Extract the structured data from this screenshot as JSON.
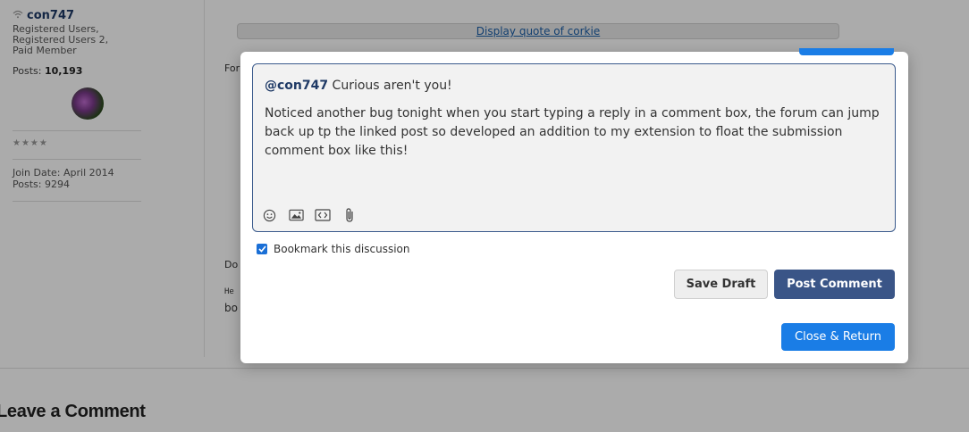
{
  "author": {
    "username": "con747",
    "roles": [
      "Registered Users,",
      "Registered Users 2,",
      "Paid Member"
    ],
    "posts_label": "Posts:",
    "posts_count": "10,193",
    "stars": "★★★★",
    "join_date": "Join Date: April 2014",
    "posts_alt": "Posts: 9294"
  },
  "thread": {
    "quote_link": "Display quote of corkie",
    "stub_for": "For",
    "stub_do": "Do",
    "stub_he": "He",
    "stub_bo": "bo"
  },
  "page": {
    "leave_comment": "Leave a Comment"
  },
  "editor": {
    "mention": "@con747",
    "first_line_rest": " Curious aren't you!",
    "paragraph": "Noticed another bug tonight when you start typing a reply in a comment box, the forum can jump back up tp the linked post so developed an addition to my extension to float the submission comment box like this!",
    "toolbar_icons": [
      "emoji-icon",
      "image-icon",
      "code-icon",
      "attachment-icon"
    ]
  },
  "bookmark": {
    "label": "Bookmark this discussion",
    "checked": true
  },
  "buttons": {
    "save_draft": "Save Draft",
    "post_comment": "Post Comment",
    "close_return": "Close & Return"
  },
  "colors": {
    "accent": "#1a7de6",
    "post_button": "#3a5587",
    "username": "#1f3a66"
  }
}
